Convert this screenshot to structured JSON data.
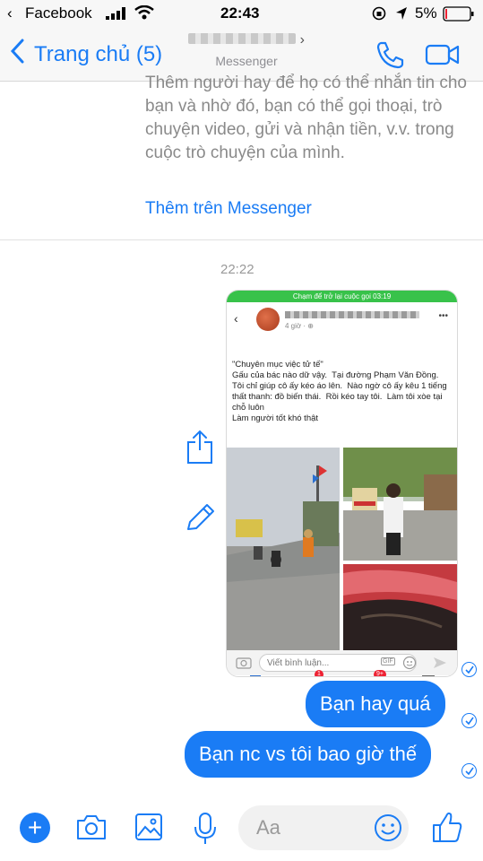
{
  "status_bar": {
    "carrier": "Facebook",
    "time": "22:43",
    "battery": "5%"
  },
  "nav": {
    "back_label": "Trang chủ (5)",
    "subtitle": "Messenger"
  },
  "intro": {
    "text": "Thêm người hay để họ có thể nhắn tin cho bạn và nhờ đó, bạn có thể gọi thoại, trò chuyện video, gửi và nhận tiền, v.v. trong cuộc trò chuyện của mình.",
    "link": "Thêm trên Messenger"
  },
  "timestamp": "22:22",
  "shared_post": {
    "call_bar": "Chạm để trở lại cuộc gọi 03:19",
    "post_time": "4 giờ · ⊕",
    "post_text": "\"Chuyên mục việc tử tế\"\nGấu của bác nào dữ vậy.  Tại đường Phạm Văn Đồng.  Tôi chỉ giúp cô ấy kéo áo lên.  Nào ngờ cô ấy kêu 1 tiếng thất thanh: đồ biến thái.  Rồi kéo tay tôi.  Làm tôi xòe tại chỗ luôn\nLàm người tốt khó thật",
    "comment_placeholder": "Viết bình luận...",
    "badge_1": "1",
    "badge_2": "9+"
  },
  "messages": [
    {
      "text": "Bạn hay quá"
    },
    {
      "text": "Bạn nc vs tôi bao giờ thế"
    }
  ],
  "composer": {
    "placeholder": "Aa"
  },
  "colors": {
    "accent": "#1a7cf5",
    "call_green": "#38c24a"
  }
}
